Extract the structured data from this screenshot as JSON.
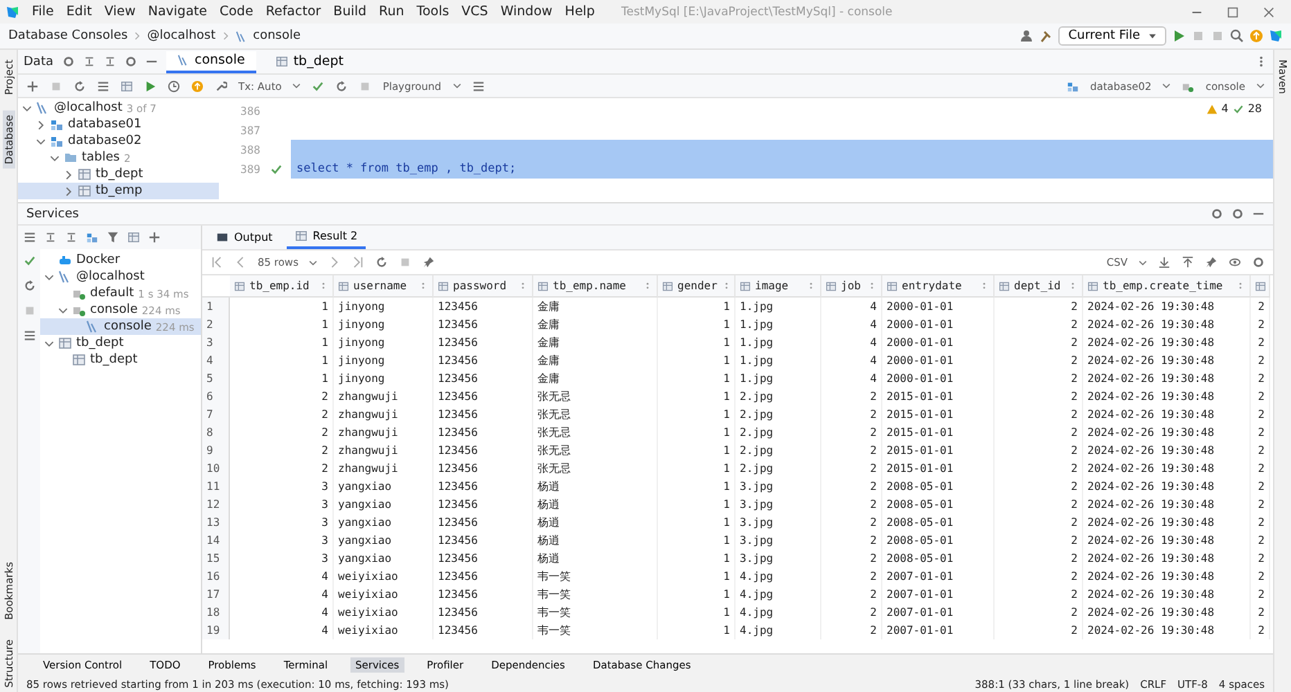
{
  "window": {
    "title": "TestMySql [E:\\JavaProject\\TestMySql] - console"
  },
  "menu": [
    "File",
    "Edit",
    "View",
    "Navigate",
    "Code",
    "Refactor",
    "Build",
    "Run",
    "Tools",
    "VCS",
    "Window",
    "Help"
  ],
  "breadcrumb": [
    "Database Consoles",
    "@localhost",
    "console"
  ],
  "run_config": "Current File",
  "side_tabs_left": [
    {
      "label": "Project",
      "selected": false
    },
    {
      "label": "Database",
      "selected": true
    },
    {
      "label": "Bookmarks",
      "selected": false
    },
    {
      "label": "Structure",
      "selected": false
    }
  ],
  "side_tabs_right": [
    {
      "label": "Maven",
      "selected": false
    }
  ],
  "db_panel": {
    "label": "Data"
  },
  "editor_tabs": [
    {
      "label": "console",
      "selected": true
    },
    {
      "label": "tb_dept",
      "selected": false
    }
  ],
  "editor_toolbar": {
    "tx": "Tx: Auto",
    "mode": "Playground",
    "schema": "database02",
    "session": "console"
  },
  "db_tree": [
    {
      "label": "@localhost",
      "hint": "3 of 7",
      "kind": "server",
      "expanded": true,
      "selected": false,
      "children": [
        {
          "label": "database01",
          "kind": "schema",
          "expanded": false,
          "selected": false
        },
        {
          "label": "database02",
          "kind": "schema",
          "expanded": true,
          "selected": false,
          "children": [
            {
              "label": "tables",
              "hint": "2",
              "kind": "folder",
              "expanded": true,
              "selected": false,
              "children": [
                {
                  "label": "tb_dept",
                  "kind": "table",
                  "expanded": false,
                  "selected": false
                },
                {
                  "label": "tb_emp",
                  "kind": "table",
                  "expanded": false,
                  "selected": true
                }
              ]
            }
          ]
        }
      ]
    }
  ],
  "editor": {
    "warnings": "4",
    "ok_count": "28",
    "lines": [
      {
        "number": "386",
        "highlighted": false,
        "executed": false
      },
      {
        "number": "387",
        "highlighted": false,
        "executed": false
      },
      {
        "number": "388",
        "highlighted": true,
        "executed": false
      },
      {
        "number": "389",
        "code": "select * from  tb_emp , tb_dept;",
        "highlighted": true,
        "executed": true
      }
    ]
  },
  "services": {
    "title": "Services",
    "tree": [
      {
        "label": "Docker",
        "kind": "docker",
        "selected": false
      },
      {
        "label": "@localhost",
        "kind": "server",
        "expanded": true,
        "selected": false,
        "children": [
          {
            "label": "default",
            "hint": "1 s 34 ms",
            "kind": "session",
            "selected": false
          },
          {
            "label": "console",
            "hint": "224 ms",
            "kind": "session",
            "expanded": true,
            "selected": false,
            "children": [
              {
                "label": "console",
                "hint": "224 ms",
                "kind": "console",
                "selected": true
              }
            ]
          }
        ]
      },
      {
        "label": "tb_dept",
        "kind": "table",
        "expanded": true,
        "selected": false,
        "children": [
          {
            "label": "tb_dept",
            "kind": "table",
            "selected": false
          }
        ]
      }
    ]
  },
  "result_tabs": [
    {
      "label": "Output",
      "selected": false
    },
    {
      "label": "Result 2",
      "selected": true
    }
  ],
  "result_toolbar": {
    "rows": "85 rows",
    "format": "CSV"
  },
  "table": {
    "columns": [
      {
        "kind": "row_number"
      },
      {
        "label": "tb_emp.id",
        "kind": "number"
      },
      {
        "label": "username",
        "kind": "text"
      },
      {
        "label": "password",
        "kind": "text"
      },
      {
        "label": "tb_emp.name",
        "kind": "text"
      },
      {
        "label": "gender",
        "kind": "number"
      },
      {
        "label": "image",
        "kind": "text"
      },
      {
        "label": "job",
        "kind": "number"
      },
      {
        "label": "entrydate",
        "kind": "text"
      },
      {
        "label": "dept_id",
        "kind": "number"
      },
      {
        "label": "tb_emp.create_time",
        "kind": "text"
      },
      {
        "kind": "number"
      }
    ],
    "rows": [
      [
        "1",
        "1",
        "jinyong",
        "123456",
        "金庸",
        "1",
        "1.jpg",
        "4",
        "2000-01-01",
        "2",
        "2024-02-26 19:30:48",
        "2"
      ],
      [
        "2",
        "1",
        "jinyong",
        "123456",
        "金庸",
        "1",
        "1.jpg",
        "4",
        "2000-01-01",
        "2",
        "2024-02-26 19:30:48",
        "2"
      ],
      [
        "3",
        "1",
        "jinyong",
        "123456",
        "金庸",
        "1",
        "1.jpg",
        "4",
        "2000-01-01",
        "2",
        "2024-02-26 19:30:48",
        "2"
      ],
      [
        "4",
        "1",
        "jinyong",
        "123456",
        "金庸",
        "1",
        "1.jpg",
        "4",
        "2000-01-01",
        "2",
        "2024-02-26 19:30:48",
        "2"
      ],
      [
        "5",
        "1",
        "jinyong",
        "123456",
        "金庸",
        "1",
        "1.jpg",
        "4",
        "2000-01-01",
        "2",
        "2024-02-26 19:30:48",
        "2"
      ],
      [
        "6",
        "2",
        "zhangwuji",
        "123456",
        "张无忌",
        "1",
        "2.jpg",
        "2",
        "2015-01-01",
        "2",
        "2024-02-26 19:30:48",
        "2"
      ],
      [
        "7",
        "2",
        "zhangwuji",
        "123456",
        "张无忌",
        "1",
        "2.jpg",
        "2",
        "2015-01-01",
        "2",
        "2024-02-26 19:30:48",
        "2"
      ],
      [
        "8",
        "2",
        "zhangwuji",
        "123456",
        "张无忌",
        "1",
        "2.jpg",
        "2",
        "2015-01-01",
        "2",
        "2024-02-26 19:30:48",
        "2"
      ],
      [
        "9",
        "2",
        "zhangwuji",
        "123456",
        "张无忌",
        "1",
        "2.jpg",
        "2",
        "2015-01-01",
        "2",
        "2024-02-26 19:30:48",
        "2"
      ],
      [
        "10",
        "2",
        "zhangwuji",
        "123456",
        "张无忌",
        "1",
        "2.jpg",
        "2",
        "2015-01-01",
        "2",
        "2024-02-26 19:30:48",
        "2"
      ],
      [
        "11",
        "3",
        "yangxiao",
        "123456",
        "杨逍",
        "1",
        "3.jpg",
        "2",
        "2008-05-01",
        "2",
        "2024-02-26 19:30:48",
        "2"
      ],
      [
        "12",
        "3",
        "yangxiao",
        "123456",
        "杨逍",
        "1",
        "3.jpg",
        "2",
        "2008-05-01",
        "2",
        "2024-02-26 19:30:48",
        "2"
      ],
      [
        "13",
        "3",
        "yangxiao",
        "123456",
        "杨逍",
        "1",
        "3.jpg",
        "2",
        "2008-05-01",
        "2",
        "2024-02-26 19:30:48",
        "2"
      ],
      [
        "14",
        "3",
        "yangxiao",
        "123456",
        "杨逍",
        "1",
        "3.jpg",
        "2",
        "2008-05-01",
        "2",
        "2024-02-26 19:30:48",
        "2"
      ],
      [
        "15",
        "3",
        "yangxiao",
        "123456",
        "杨逍",
        "1",
        "3.jpg",
        "2",
        "2008-05-01",
        "2",
        "2024-02-26 19:30:48",
        "2"
      ],
      [
        "16",
        "4",
        "weiyixiao",
        "123456",
        "韦一笑",
        "1",
        "4.jpg",
        "2",
        "2007-01-01",
        "2",
        "2024-02-26 19:30:48",
        "2"
      ],
      [
        "17",
        "4",
        "weiyixiao",
        "123456",
        "韦一笑",
        "1",
        "4.jpg",
        "2",
        "2007-01-01",
        "2",
        "2024-02-26 19:30:48",
        "2"
      ],
      [
        "18",
        "4",
        "weiyixiao",
        "123456",
        "韦一笑",
        "1",
        "4.jpg",
        "2",
        "2007-01-01",
        "2",
        "2024-02-26 19:30:48",
        "2"
      ],
      [
        "19",
        "4",
        "weiyixiao",
        "123456",
        "韦一笑",
        "1",
        "4.jpg",
        "2",
        "2007-01-01",
        "2",
        "2024-02-26 19:30:48",
        "2"
      ]
    ]
  },
  "tool_windows": [
    {
      "label": "Version Control",
      "selected": false
    },
    {
      "label": "TODO",
      "selected": false
    },
    {
      "label": "Problems",
      "selected": false
    },
    {
      "label": "Terminal",
      "selected": false
    },
    {
      "label": "Services",
      "selected": true
    },
    {
      "label": "Profiler",
      "selected": false
    },
    {
      "label": "Dependencies",
      "selected": false
    },
    {
      "label": "Database Changes",
      "selected": false
    }
  ],
  "status_bar": {
    "message": "85 rows retrieved starting from 1 in 203 ms (execution: 10 ms, fetching: 193 ms)",
    "position": "388:1 (33 chars, 1 line break)",
    "line_ending": "CRLF",
    "encoding": "UTF-8",
    "indent": "4 spaces"
  }
}
